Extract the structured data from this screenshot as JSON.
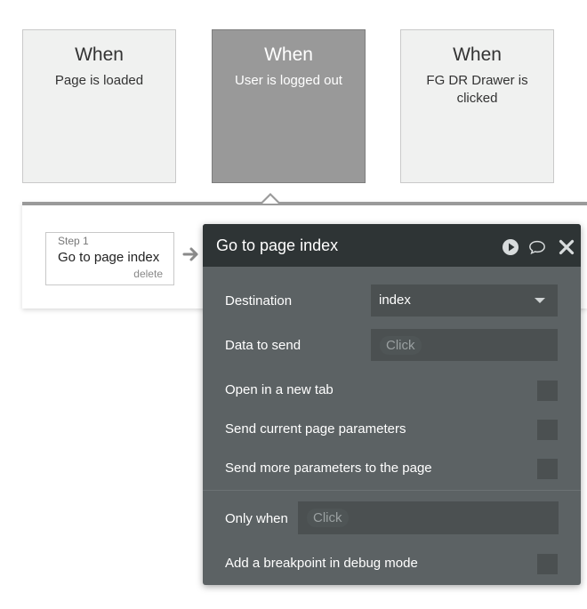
{
  "events": [
    {
      "when": "When",
      "condition": "Page is loaded"
    },
    {
      "when": "When",
      "condition": "User is logged out"
    },
    {
      "when": "When",
      "condition": "FG DR Drawer is clicked"
    }
  ],
  "step": {
    "number": "Step 1",
    "title": "Go to page index",
    "delete_label": "delete"
  },
  "panel": {
    "title": "Go to page index",
    "destination_label": "Destination",
    "destination_value": "index",
    "data_label": "Data to send",
    "click_label": "Click",
    "new_tab_label": "Open in a new tab",
    "current_params_label": "Send current page parameters",
    "more_params_label": "Send more parameters to the page",
    "only_when_label": "Only when",
    "breakpoint_label": "Add a breakpoint in debug mode"
  },
  "colors": {
    "header_bg": "#2e3435",
    "panel_bg": "#5c6264",
    "field_bg": "#4b5051",
    "selected_card": "#999999"
  }
}
